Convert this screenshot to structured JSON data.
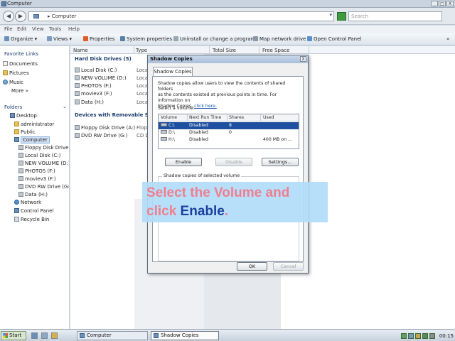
{
  "window": {
    "title": "Computer",
    "controls": [
      "_",
      "□",
      "X"
    ]
  },
  "address": {
    "path": "▸ Computer",
    "search_placeholder": "Search"
  },
  "menu": [
    "File",
    "Edit",
    "View",
    "Tools",
    "Help"
  ],
  "toolbar": {
    "organize": "Organize ▾",
    "views": "Views ▾",
    "properties": "Properties",
    "system_properties": "System properties",
    "uninstall": "Uninstall or change a program",
    "map_drive": "Map network drive",
    "control_panel": "Open Control Panel",
    "overflow": "»"
  },
  "nav": {
    "favorites_header": "Favorite Links",
    "favorites": [
      "Documents",
      "Pictures",
      "Music",
      "More »"
    ],
    "folders_header": "Folders",
    "tree": [
      "Desktop",
      "administrator",
      "Public",
      "Computer",
      "Floppy Disk Drive (A",
      "Local Disk (C:)",
      "NEW VOLUME (D:)",
      "PHOTOS (F:)",
      "moviev3 (F:)",
      "DVD RW Drive (G:)",
      "Data (H:)",
      "Network",
      "Control Panel",
      "Recycle Bin"
    ]
  },
  "columns": [
    "Name",
    "Type",
    "Total Size",
    "Free Space"
  ],
  "content": {
    "group_hdd": "Hard Disk Drives (5)",
    "hdd": [
      "Local Disk (C:)",
      "NEW VOLUME (D:)",
      "PHOTOS (F:)",
      "moviev3 (F:)",
      "Data (H:)"
    ],
    "hdd_types": [
      "Local",
      "Local",
      "Local",
      "Local",
      "Local"
    ],
    "group_removable": "Devices with Removable St",
    "removable": [
      "Floppy Disk Drive (A:)",
      "DVD RW Drive (G:)"
    ],
    "removable_types": [
      "Flopp",
      "CD D"
    ]
  },
  "dialog": {
    "title": "Shadow Copies",
    "tab": "Shadow Copies",
    "desc_line1": "Shadow copies allow users to view the contents of shared folders",
    "desc_line2": "as the contents existed at previous points in time. For information on",
    "desc_line3": "Shadow Copies,",
    "desc_link": "click here.",
    "select_label": "Select a volume:",
    "vol_headers": [
      "Volume",
      "Next Run Time",
      "Shares",
      "Used"
    ],
    "volumes": [
      {
        "volume": "C:\\",
        "next_run": "Disabled",
        "shares": "8",
        "used": ""
      },
      {
        "volume": "D:\\",
        "next_run": "Disabled",
        "shares": "0",
        "used": ""
      },
      {
        "volume": "H:\\",
        "next_run": "Disabled",
        "shares": "",
        "used": "400 MB on ..."
      }
    ],
    "btn_enable": "Enable",
    "btn_disable": "Disable",
    "btn_settings": "Settings...",
    "group_label": "Shadow copies of selected volume",
    "btn_ok": "OK",
    "btn_cancel": "Cancel"
  },
  "callout": {
    "line1": "Select the Volume and",
    "line2_pre": "click ",
    "line2_bold": "Enable",
    "line2_post": "."
  },
  "taskbar": {
    "start": "Start",
    "items": [
      "Computer",
      "Shadow Copies"
    ],
    "clock": "00:15"
  }
}
